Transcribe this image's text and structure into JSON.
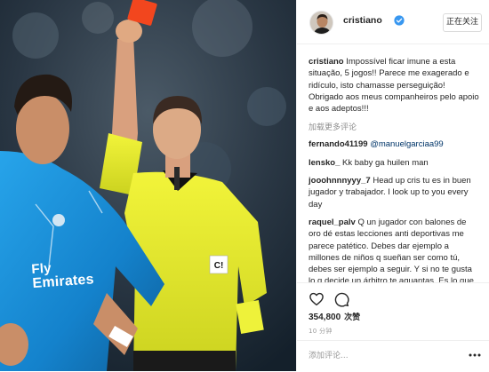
{
  "header": {
    "username": "cristiano",
    "follow_label": "正在关注",
    "avatar": "profile-avatar",
    "verified": "verified-badge-icon"
  },
  "photo": {
    "jersey_text_line1": "Fly",
    "jersey_text_line2": "Emirates",
    "referee_badge": "C!"
  },
  "caption": {
    "username": "cristiano",
    "text": "Impossível ficar imune a esta situação, 5 jogos!! Parece me exagerado e ridículo, isto chamasse perseguição! Obrigado aos meus companheiros pelo apoio e aos adeptos!!!"
  },
  "load_more_label": "加载更多评论",
  "comments": [
    {
      "username": "fernando41199",
      "text": "@manuelgarciaa99"
    },
    {
      "username": "lensko_",
      "text": "Kk baby ga huilen man"
    },
    {
      "username": "jooohnnnyyy_7",
      "text": "Head up cris tu es in buen jugador y trabajador. I look up to you every day"
    },
    {
      "username": "raquel_palv",
      "text": "Q un jugador con balones de oro dé estas lecciones anti deportivas me parece patético. Debes dar ejemplo a millones de niños q sueñan ser como tú, debes ser ejemplo a seguir. Y si no te gusta lo q decide un árbitro te aguantas. Es lo que hay. A veces se gana y a veces se pierde campeón..."
    }
  ],
  "actions": {
    "like_icon": "heart-outline-icon",
    "comment_icon": "speech-bubble-icon",
    "likes_count": "354,800",
    "likes_unit": "次赞",
    "timestamp": "10 分钟"
  },
  "add_comment": {
    "placeholder": "添加评论...",
    "more_icon": "ellipsis-icon"
  },
  "colors": {
    "text": "#262626",
    "muted": "#999999",
    "mention": "#003569",
    "divider": "#efefef",
    "verified": "#3897f0",
    "referee_shirt": "#e6e82a",
    "card_red": "#f2461e",
    "card_yellow": "#eef23a",
    "kit_blue": "#1a8fd8"
  }
}
